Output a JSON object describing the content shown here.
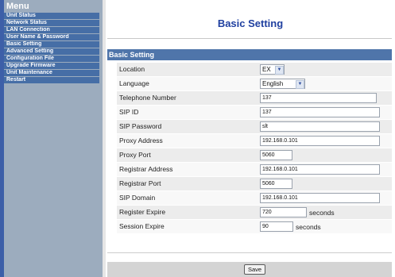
{
  "sidebar": {
    "title": "Menu",
    "items": [
      {
        "label": "Unit Status"
      },
      {
        "label": "Network Status"
      },
      {
        "label": "LAN Connection"
      },
      {
        "label": "User Name & Password"
      },
      {
        "label": "Basic Setting"
      },
      {
        "label": "Advanced Setting"
      },
      {
        "label": "Configuration File"
      },
      {
        "label": "Upgrade Firmware"
      },
      {
        "label": "Unit Maintenance"
      },
      {
        "label": "Restart"
      }
    ]
  },
  "page": {
    "title": "Basic Setting",
    "section": "Basic Setting",
    "save_label": "Save"
  },
  "form": {
    "location": {
      "label": "Location",
      "value": "EX"
    },
    "language": {
      "label": "Language",
      "value": "English"
    },
    "telephone_number": {
      "label": "Telephone Number",
      "value": "137"
    },
    "sip_id": {
      "label": "SIP ID",
      "value": "137"
    },
    "sip_password": {
      "label": "SIP Password",
      "value": "slt"
    },
    "proxy_address": {
      "label": "Proxy Address",
      "value": "192.168.0.101"
    },
    "proxy_port": {
      "label": "Proxy Port",
      "value": "5060"
    },
    "registrar_address": {
      "label": "Registrar Address",
      "value": "192.168.0.101"
    },
    "registrar_port": {
      "label": "Registrar Port",
      "value": "5060"
    },
    "sip_domain": {
      "label": "SIP Domain",
      "value": "192.168.0.101"
    },
    "register_expire": {
      "label": "Register Expire",
      "value": "720",
      "unit": "seconds"
    },
    "session_expire": {
      "label": "Session Expire",
      "value": "90",
      "unit": "seconds"
    }
  },
  "colors": {
    "sidebar_bg": "#9cacbe",
    "menu_item_bg": "#466ea6",
    "section_bar_bg": "#4f75aa",
    "title_color": "#2040a0"
  }
}
